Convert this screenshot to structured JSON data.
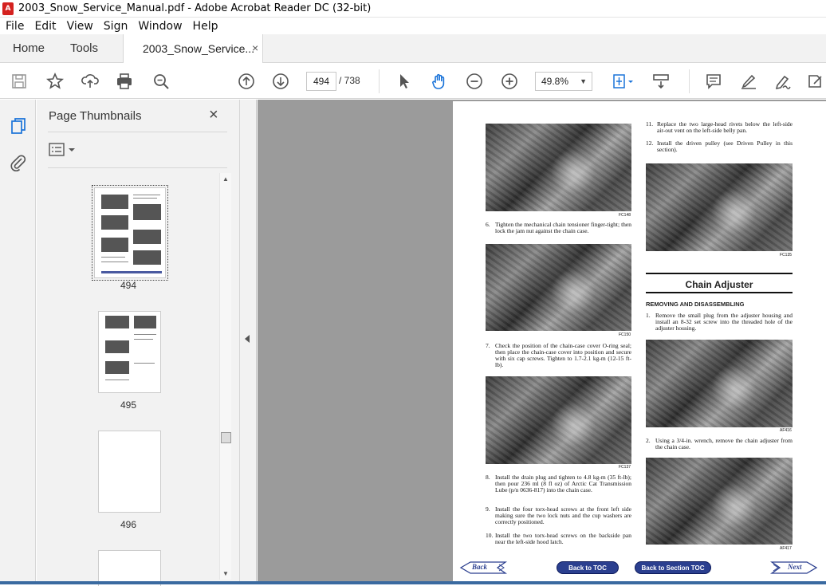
{
  "window": {
    "title": "2003_Snow_Service_Manual.pdf - Adobe Acrobat Reader DC (32-bit)"
  },
  "menu": [
    "File",
    "Edit",
    "View",
    "Sign",
    "Window",
    "Help"
  ],
  "tabs": {
    "home": "Home",
    "tools": "Tools",
    "document": "2003_Snow_Service...",
    "close": "×"
  },
  "toolbar": {
    "current_page": "494",
    "total_pages": "/ 738",
    "zoom": "49.8%"
  },
  "panel": {
    "title": "Page Thumbnails",
    "close": "×",
    "thumbnails": [
      {
        "label": "494"
      },
      {
        "label": "495"
      },
      {
        "label": "496"
      }
    ]
  },
  "page": {
    "steps_left": [
      {
        "num": "6.",
        "text": "Tighten the mechanical chain tensioner finger-tight; then lock the jam nut against the chain case."
      },
      {
        "num": "7.",
        "text": "Check the position of the chain-case cover O-ring seal; then place the chain-case cover into position and secure with six cap screws. Tighten to 1.7-2.1 kg-m (12-15 ft-lb)."
      },
      {
        "num": "8.",
        "text": "Install the drain plug and tighten to 4.8 kg-m (35 ft-lb); then pour 236 ml (8 fl oz) of Arctic Cat Transmission Lube (p/n 0636-817) into the chain case."
      },
      {
        "num": "9.",
        "text": "Install the four torx-head screws at the front left side making sure the two lock nuts and the cup washers are correctly positioned."
      },
      {
        "num": "10.",
        "text": "Install the two torx-head screws on the backside pan near the left-side hood latch."
      }
    ],
    "steps_right": [
      {
        "num": "11.",
        "text": "Replace the two large-head rivets below the left-side air-out vent on the left-side belly pan."
      },
      {
        "num": "12.",
        "text": "Install the driven pulley (see Driven Pulley in this section)."
      }
    ],
    "section_title": "Chain Adjuster",
    "subsection": "REMOVING AND DISASSEMBLING",
    "adjuster_steps": [
      {
        "num": "1.",
        "text": "Remove the small plug from the adjuster housing and install an 8-32 set screw into the threaded hole of the adjuster housing."
      },
      {
        "num": "2.",
        "text": "Using a 3/4-in. wrench, remove the chain adjuster from the chain case."
      }
    ],
    "figures": [
      "FC148",
      "FC150",
      "FC137",
      "FC135",
      "AF416",
      "AF417"
    ],
    "nav": {
      "back": "Back",
      "toc": "Back to TOC",
      "section_toc": "Back to Section TOC",
      "next": "Next"
    }
  }
}
